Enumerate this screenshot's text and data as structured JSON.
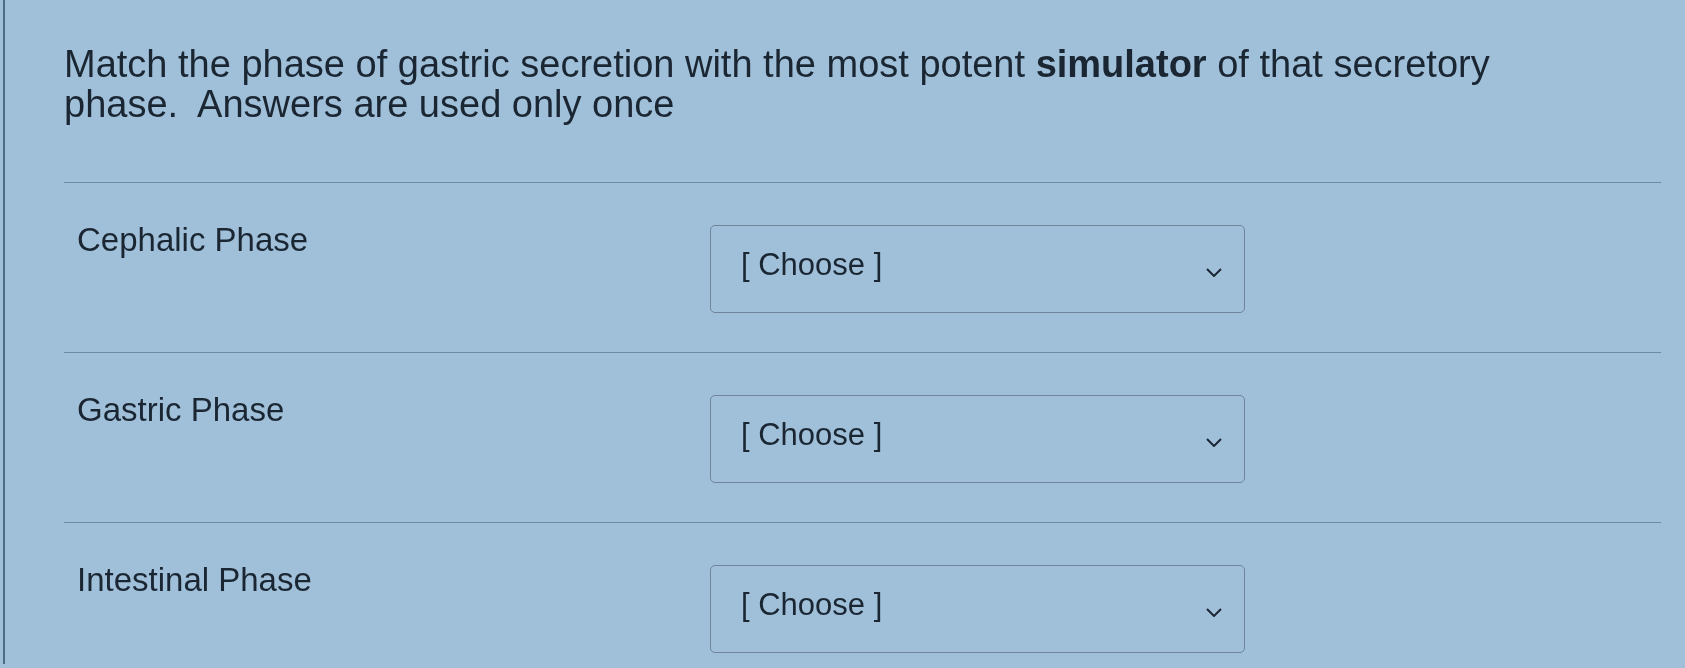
{
  "question": {
    "text": "Match the phase of gastric secretion with the most potent **simulator** of that secretory phase.  Answers are used only once"
  },
  "rows": [
    {
      "label": "Cephalic Phase",
      "select": {
        "value": "[ Choose ]"
      }
    },
    {
      "label": "Gastric Phase",
      "select": {
        "value": "[ Choose ]"
      }
    },
    {
      "label": "Intestinal Phase",
      "select": {
        "value": "[ Choose ]"
      }
    }
  ]
}
